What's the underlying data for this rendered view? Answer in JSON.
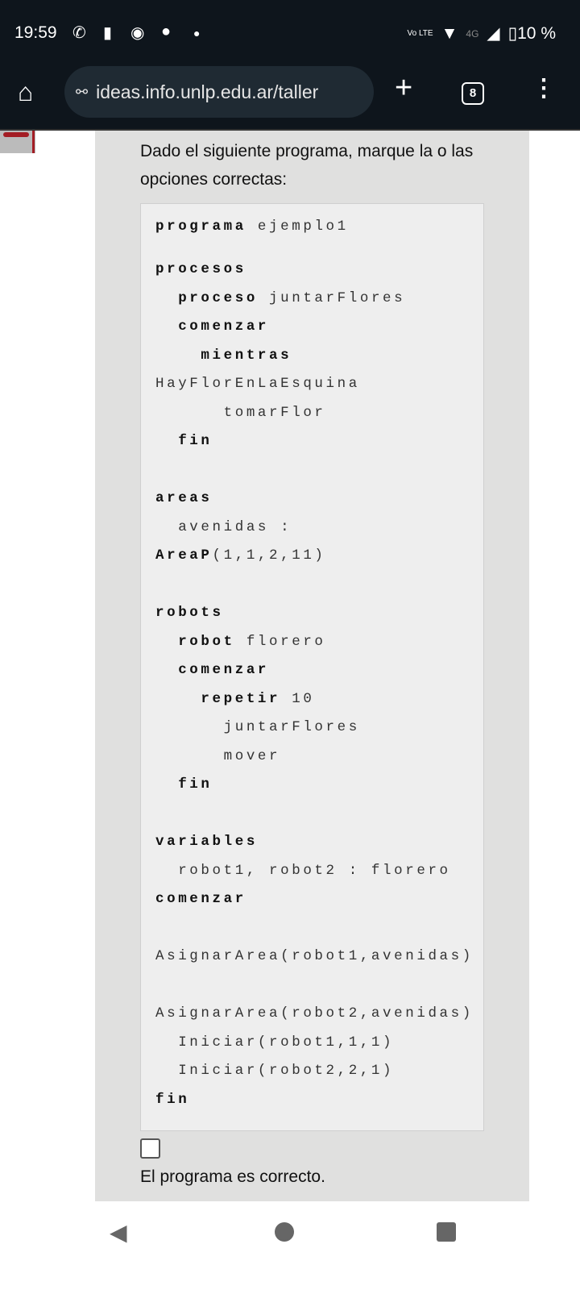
{
  "status": {
    "time": "19:59",
    "network": "4G",
    "battery": "10 %",
    "volte": "Vo LTE"
  },
  "browser": {
    "url": "ideas.info.unlp.edu.ar/taller",
    "tab_count": "8"
  },
  "question": {
    "prompt": "Dado el siguiente programa, marque la o las opciones correctas:"
  },
  "code_lines": [
    {
      "kw": "programa",
      "rest": " ejemplo1"
    },
    {
      "kw": "procesos",
      "rest": ""
    },
    {
      "kw": "  proceso",
      "rest": " juntarFlores"
    },
    {
      "kw": "  comenzar",
      "rest": ""
    },
    {
      "kw": "    mientras",
      "rest": ""
    },
    {
      "kw": "",
      "rest": "HayFlorEnLaEsquina"
    },
    {
      "kw": "",
      "rest": "      tomarFlor"
    },
    {
      "kw": "  fin",
      "rest": ""
    },
    {
      "kw": "",
      "rest": ""
    },
    {
      "kw": "areas",
      "rest": ""
    },
    {
      "kw": "",
      "rest": "  avenidas :"
    },
    {
      "kw": "AreaP",
      "rest": "(1,1,2,11)"
    },
    {
      "kw": "",
      "rest": ""
    },
    {
      "kw": "robots",
      "rest": ""
    },
    {
      "kw": "  robot",
      "rest": " florero"
    },
    {
      "kw": "  comenzar",
      "rest": ""
    },
    {
      "kw": "    repetir",
      "rest": " 10"
    },
    {
      "kw": "",
      "rest": "      juntarFlores"
    },
    {
      "kw": "",
      "rest": "      mover"
    },
    {
      "kw": "  fin",
      "rest": ""
    },
    {
      "kw": "",
      "rest": ""
    },
    {
      "kw": "variables",
      "rest": ""
    },
    {
      "kw": "",
      "rest": "  robot1, robot2 : florero"
    },
    {
      "kw": "comenzar",
      "rest": ""
    },
    {
      "kw": "",
      "rest": ""
    },
    {
      "kw": "",
      "rest": "AsignarArea(robot1,avenidas)"
    },
    {
      "kw": "",
      "rest": ""
    },
    {
      "kw": "",
      "rest": "AsignarArea(robot2,avenidas)"
    },
    {
      "kw": "",
      "rest": "  Iniciar(robot1,1,1)"
    },
    {
      "kw": "",
      "rest": "  Iniciar(robot2,2,1)"
    },
    {
      "kw": "fin",
      "rest": ""
    }
  ],
  "option": {
    "label": "El programa es correcto.",
    "checked": false
  }
}
